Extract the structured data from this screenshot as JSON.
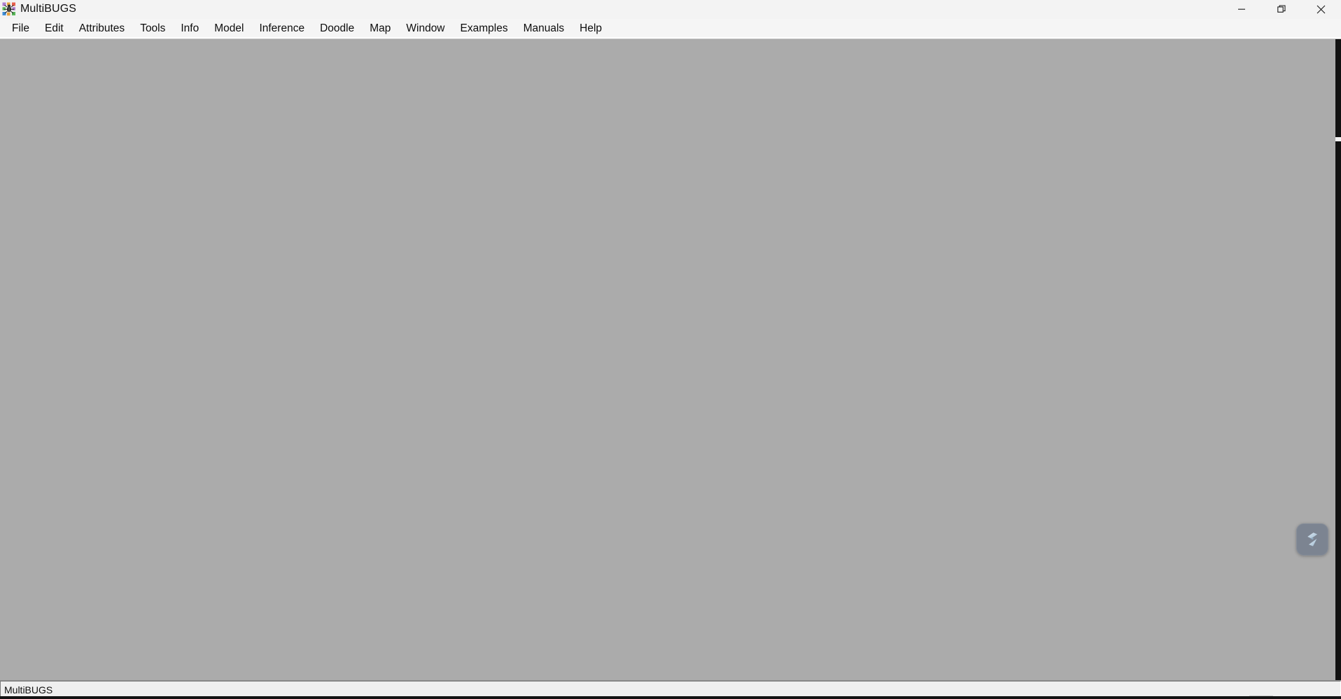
{
  "window": {
    "title": "MultiBUGS",
    "app_icon": "bugs-app-icon",
    "controls": {
      "minimize": "Minimize",
      "restore": "Restore",
      "close": "Close"
    }
  },
  "menu": {
    "items": [
      {
        "label": "File"
      },
      {
        "label": "Edit"
      },
      {
        "label": "Attributes"
      },
      {
        "label": "Tools"
      },
      {
        "label": "Info"
      },
      {
        "label": "Model"
      },
      {
        "label": "Inference"
      },
      {
        "label": "Doodle"
      },
      {
        "label": "Map"
      },
      {
        "label": "Window"
      },
      {
        "label": "Examples"
      },
      {
        "label": "Manuals"
      },
      {
        "label": "Help"
      }
    ]
  },
  "workspace": {
    "content": "",
    "background_color": "#ababab"
  },
  "assistant": {
    "icon": "lightning-bolt-icon",
    "background_color": "#7c8491",
    "glyph_color": "#c3d6e6"
  },
  "status_bar": {
    "text": "MultiBUGS"
  }
}
